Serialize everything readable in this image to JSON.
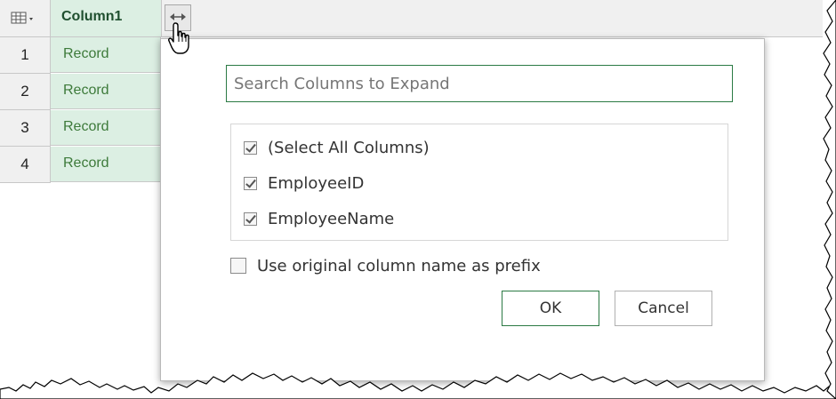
{
  "grid": {
    "column_header": "Column1",
    "rows": [
      {
        "num": "1",
        "value": "Record"
      },
      {
        "num": "2",
        "value": "Record"
      },
      {
        "num": "3",
        "value": "Record"
      },
      {
        "num": "4",
        "value": "Record"
      }
    ],
    "accent_color": "#dcefe3"
  },
  "expand_panel": {
    "search_placeholder": "Search Columns to Expand",
    "items": [
      {
        "label": "(Select All Columns)",
        "checked": true
      },
      {
        "label": "EmployeeID",
        "checked": true
      },
      {
        "label": "EmployeeName",
        "checked": true
      }
    ],
    "prefix_option": {
      "label": "Use original column name as prefix",
      "checked": false
    },
    "ok_label": "OK",
    "cancel_label": "Cancel",
    "accent_color": "#2b7a44"
  },
  "icons": {
    "table_menu": "table-icon",
    "expand": "expand-arrows-icon",
    "cursor": "hand-pointer-icon"
  }
}
